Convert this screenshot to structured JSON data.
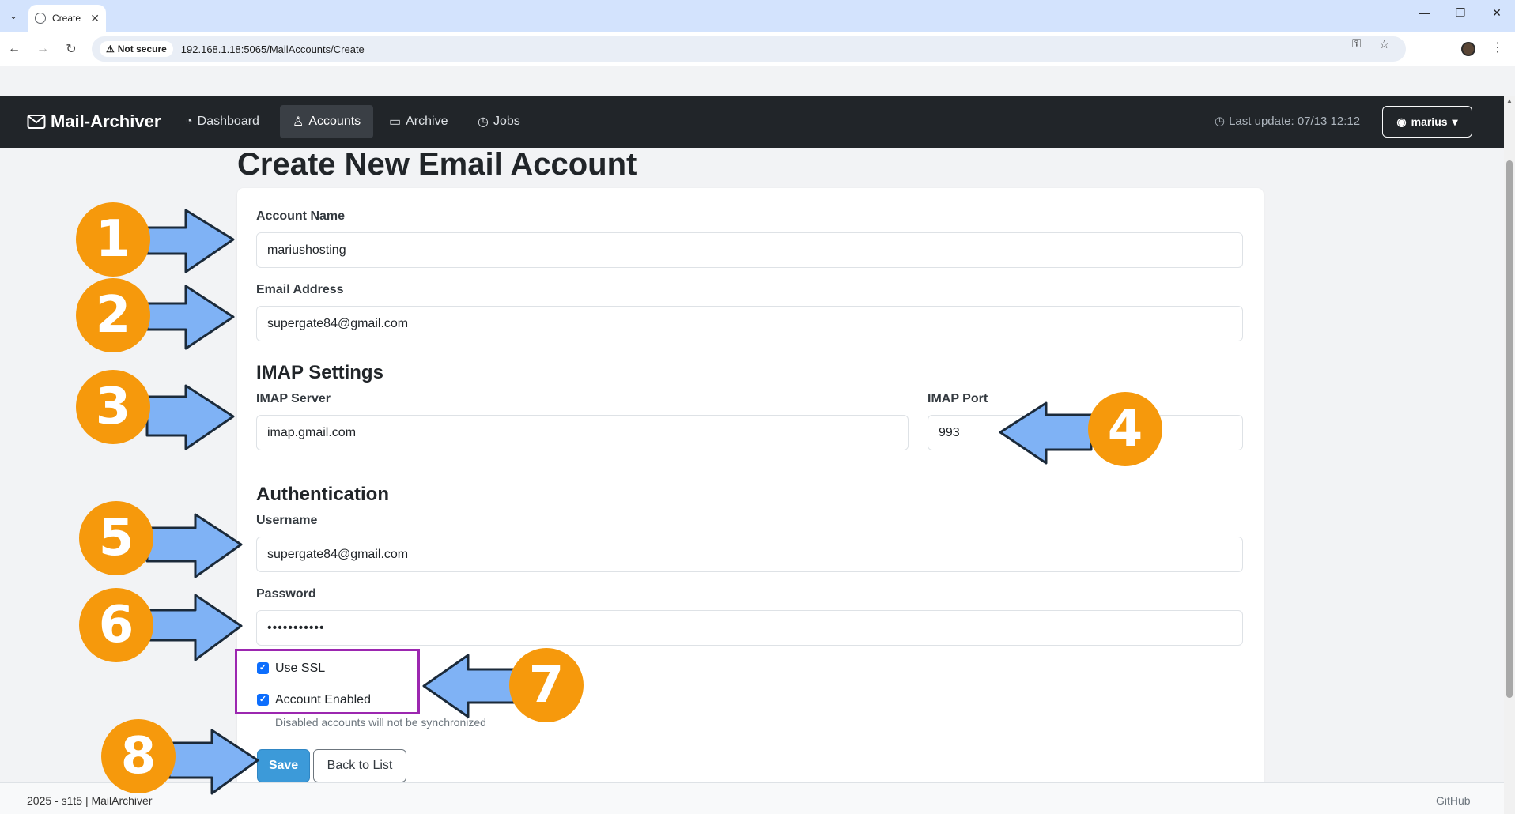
{
  "browser": {
    "tab_title": "Create",
    "security_label": "Not secure",
    "url": "192.168.1.18:5065/MailAccounts/Create"
  },
  "navbar": {
    "brand": "Mail-Archiver",
    "links": [
      {
        "label": "Dashboard",
        "icon": "dashboard-icon"
      },
      {
        "label": "Accounts",
        "icon": "person-icon",
        "active": true
      },
      {
        "label": "Archive",
        "icon": "archive-icon"
      },
      {
        "label": "Jobs",
        "icon": "clock-icon"
      }
    ],
    "last_update": "Last update: 07/13 12:12",
    "user": "marius"
  },
  "page": {
    "title": "Create New Email Account"
  },
  "form": {
    "account_name_label": "Account Name",
    "account_name_value": "mariushosting",
    "email_label": "Email Address",
    "email_value": "supergate84@gmail.com",
    "imap_heading": "IMAP Settings",
    "imap_server_label": "IMAP Server",
    "imap_server_value": "imap.gmail.com",
    "imap_port_label": "IMAP Port",
    "imap_port_value": "993",
    "auth_heading": "Authentication",
    "username_label": "Username",
    "username_value": "supergate84@gmail.com",
    "password_label": "Password",
    "password_value": "•••••••••••",
    "use_ssl_label": "Use SSL",
    "use_ssl_checked": true,
    "account_enabled_label": "Account Enabled",
    "account_enabled_checked": true,
    "account_enabled_hint": "Disabled accounts will not be synchronized",
    "save_label": "Save",
    "back_label": "Back to List"
  },
  "footer": {
    "text": "2025 - s1t5 | MailArchiver",
    "link": "GitHub"
  },
  "annotations": {
    "badges": [
      "1",
      "2",
      "3",
      "4",
      "5",
      "6",
      "7",
      "8"
    ],
    "badge_color": "#f6990c",
    "arrow_color": "#7fb2f5",
    "highlight_color": "#9c27b0"
  }
}
